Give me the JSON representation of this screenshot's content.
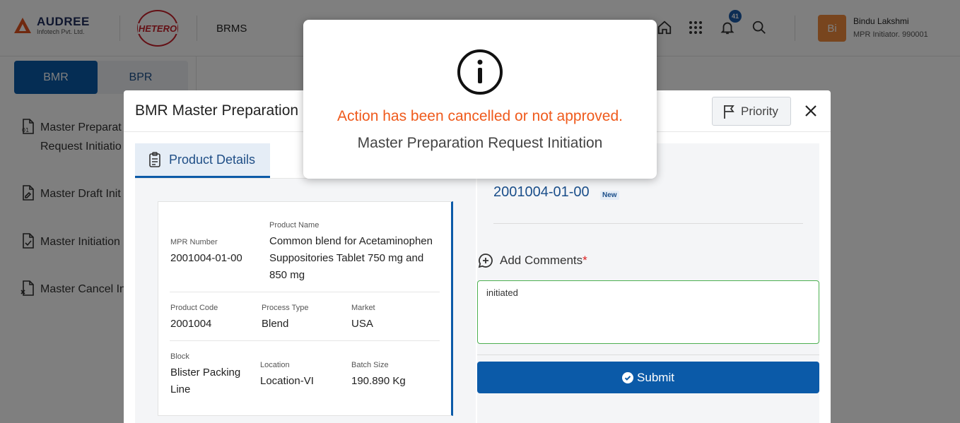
{
  "header": {
    "company_name": "AUDREE",
    "company_sub": "Infotech Pvt. Ltd.",
    "client_logo": "HETERO",
    "app_name": "BRMS",
    "notifications_count": "41",
    "user_initials": "Bi",
    "user_name": "Bindu Lakshmi",
    "user_role": "MPR Initiator. 990001"
  },
  "sidebar": {
    "tabs": [
      "BMR",
      "BPR"
    ],
    "items": [
      {
        "label": "Master Preparat",
        "label2": "Request Initiatio",
        "icon": "document-01-icon"
      },
      {
        "label": "Master Draft Init",
        "icon": "document-edit-icon"
      },
      {
        "label": "Master Initiation",
        "icon": "document-check-icon"
      },
      {
        "label": "Master Cancel In",
        "icon": "document-cancel-icon"
      }
    ]
  },
  "modal": {
    "title": "BMR Master Preparation",
    "priority_label": "Priority",
    "tab_label": "Product Details",
    "mpr_number_label": "MPR Number",
    "mpr_number": "2001004-01-00",
    "product_name_label": "Product Name",
    "product_name": "Common blend for Acetaminophen Suppositories Tablet 750 mg and 850 mg",
    "product_code_label": "Product Code",
    "product_code": "2001004",
    "process_type_label": "Process Type",
    "process_type": "Blend",
    "market_label": "Market",
    "market": "USA",
    "block_label": "Block",
    "block": "Blister Packing Line",
    "location_label": "Location",
    "location": "Location-VI",
    "batch_size_label": "Batch Size",
    "batch_size": "190.890 Kg",
    "mpr_id": "2001004-01-00",
    "mpr_status": "New",
    "add_comments_label": "Add Comments",
    "required_mark": "*",
    "comments_value": "initiated",
    "submit_label": "Submit"
  },
  "alert": {
    "message": "Action has been cancelled or not approved.",
    "sub_message": "Master Preparation Request Initiation",
    "icon": "info-icon"
  },
  "colors": {
    "primary": "#0b5aa8",
    "alert_message": "#ef5a1c",
    "avatar": "#f08a3c",
    "comment_border": "#4caf50"
  }
}
